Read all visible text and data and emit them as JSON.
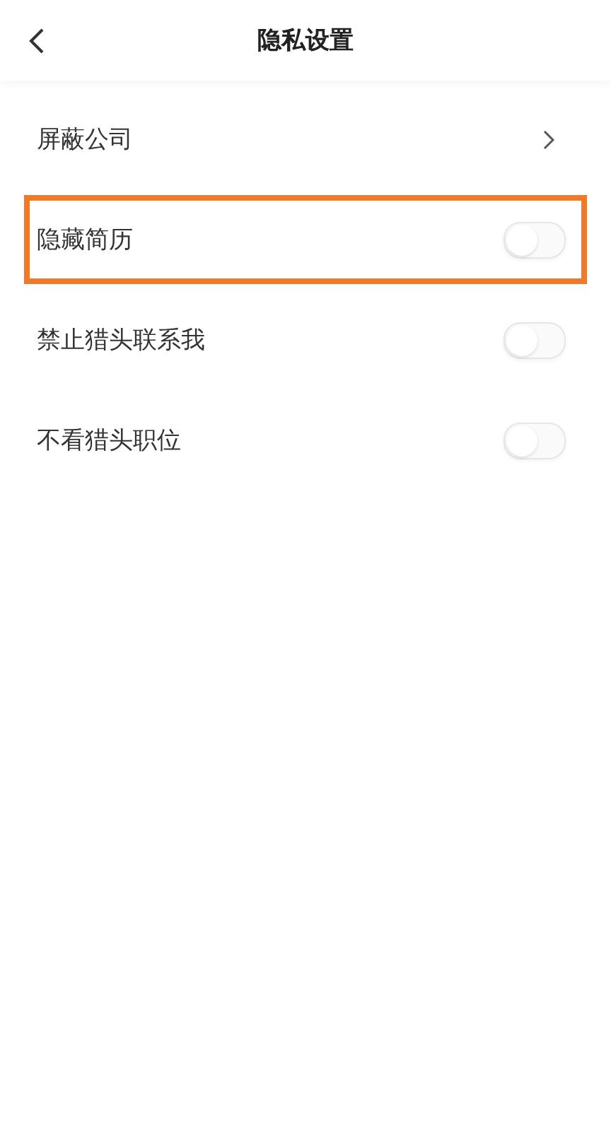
{
  "header": {
    "title": "隐私设置"
  },
  "items": [
    {
      "kind": "link",
      "label": "屏蔽公司",
      "highlighted": false
    },
    {
      "kind": "toggle",
      "label": "隐藏简历",
      "on": false,
      "highlighted": true
    },
    {
      "kind": "toggle",
      "label": "禁止猎头联系我",
      "on": false,
      "highlighted": false
    },
    {
      "kind": "toggle",
      "label": "不看猎头职位",
      "on": false,
      "highlighted": false
    }
  ]
}
